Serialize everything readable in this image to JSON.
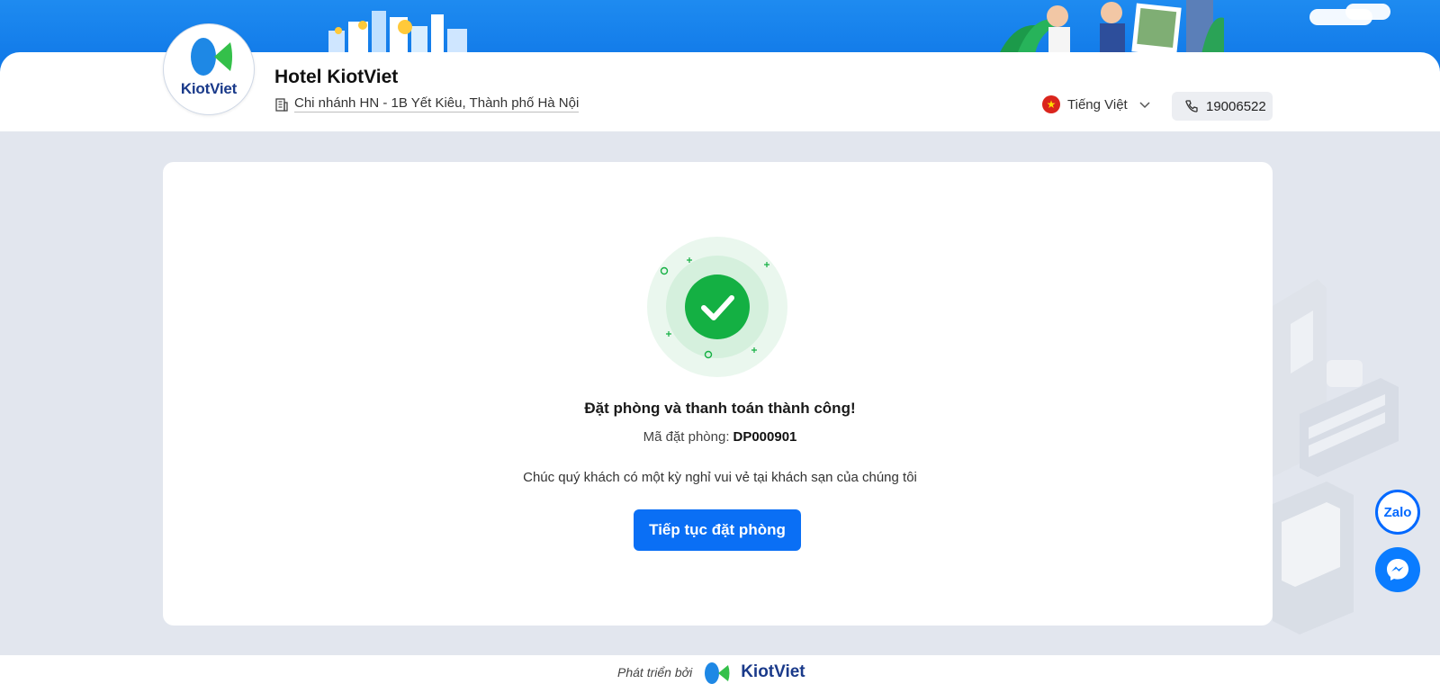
{
  "header": {
    "brand_logo_text": "KiotViet",
    "hotel_name": "Hotel KiotViet",
    "branch_label": "Chi nhánh HN - 1B Yết Kiêu, Thành phố Hà Nội",
    "language": "Tiếng Việt",
    "phone": "19006522"
  },
  "success": {
    "title": "Đặt phòng và thanh toán thành công!",
    "booking_code_label": "Mã đặt phòng:",
    "booking_code_value": "DP000901",
    "wish_text": "Chúc quý khách có một kỳ nghỉ vui vẻ tại khách sạn của chúng tôi",
    "continue_button": "Tiếp tục đặt phòng"
  },
  "floating": {
    "zalo_label": "Zalo"
  },
  "footer": {
    "developed_by": "Phát triển bởi",
    "logo_text": "KiotViet"
  },
  "colors": {
    "primary": "#0a6ff5",
    "success": "#14b043",
    "banner": "#0d74e6",
    "page_bg": "#e2e6ee"
  },
  "icons": [
    "building-icon",
    "flag-vn-icon",
    "chevron-down-icon",
    "phone-icon",
    "check-circle-icon",
    "zalo-icon",
    "messenger-icon"
  ]
}
